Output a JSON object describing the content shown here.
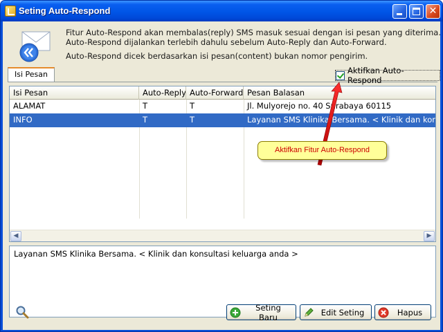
{
  "window": {
    "title": "Seting Auto-Respond"
  },
  "info": {
    "line1": "Fitur Auto-Respond akan membalas(reply) SMS masuk sesuai dengan isi pesan yang diterima.",
    "line2": "Auto-Respond dijalankan terlebih dahulu sebelum Auto-Reply dan Auto-Forward.",
    "line3": "Auto-Respond dicek berdasarkan isi pesan(content) bukan nomor pengirim."
  },
  "tab": {
    "label": "Isi Pesan"
  },
  "checkbox": {
    "label": "Aktifkan Auto-Respond",
    "checked": true
  },
  "grid": {
    "columns": [
      "Isi Pesan",
      "Auto-Reply",
      "Auto-Forward",
      "Pesan Balasan"
    ],
    "rows": [
      [
        "ALAMAT",
        "T",
        "T",
        "Jl. Mulyorejo no. 40 Surabaya 60115"
      ],
      [
        "INFO",
        "T",
        "T",
        "Layanan SMS Klinika Bersama. < Klinik dan konsultasi keluarga anda >"
      ]
    ],
    "selected_row": 1
  },
  "detail": {
    "text": "Layanan SMS Klinika Bersama. < Klinik dan konsultasi keluarga anda >"
  },
  "buttons": {
    "new": "Seting Baru",
    "edit": "Edit Seting",
    "delete": "Hapus"
  },
  "callout": {
    "text": "Aktifkan Fitur Auto-Respond"
  },
  "colors": {
    "titlebar": "#0055e6",
    "selection": "#316ac5",
    "callout_bg": "#ffff99",
    "callout_text": "#cc0000",
    "arrow": "#d40000"
  }
}
